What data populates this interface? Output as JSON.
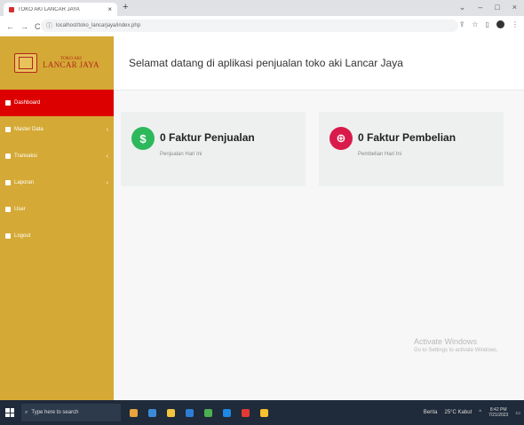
{
  "browser": {
    "tab_title": "TOKO AKI LANCAR JAYA",
    "tab_close": "×",
    "new_tab": "+",
    "window_controls": [
      "⌄",
      "–",
      "□",
      "×"
    ],
    "url": "localhost/toko_lancarjaya/index.php"
  },
  "sidebar": {
    "brand_top": "TOKO AKI",
    "brand_bottom": "LANCAR JAYA",
    "items": [
      {
        "label": "Dashboard",
        "has_caret": false
      },
      {
        "label": "Master Data",
        "has_caret": true
      },
      {
        "label": "Transaksi",
        "has_caret": true
      },
      {
        "label": "Laporan",
        "has_caret": true
      },
      {
        "label": "User",
        "has_caret": false
      },
      {
        "label": "Logout",
        "has_caret": false
      }
    ],
    "active_index": 0
  },
  "main": {
    "welcome": "Selamat datang di aplikasi penjualan toko aki Lancar Jaya",
    "cards": [
      {
        "title": "0 Faktur Penjualan",
        "subtitle": "Penjualan Hari Ini",
        "color": "#2eb85c",
        "icon": "cash-icon"
      },
      {
        "title": "0 Faktur Pembelian",
        "subtitle": "Pembelian Hari Ini",
        "color": "#d81b4b",
        "icon": "shopping-bag-icon"
      }
    ],
    "watermark_line1": "Activate Windows",
    "watermark_line2": "Go to Settings to activate Windows."
  },
  "taskbar": {
    "search_placeholder": "Type here to search",
    "news": "Berita",
    "weather": "25°C Kabut",
    "time": "8:42 PM",
    "date": "7/21/2023"
  },
  "colors": {
    "sidebar": "#d4a935",
    "active": "#dd0000",
    "green": "#2eb85c",
    "red": "#d81b4b"
  }
}
